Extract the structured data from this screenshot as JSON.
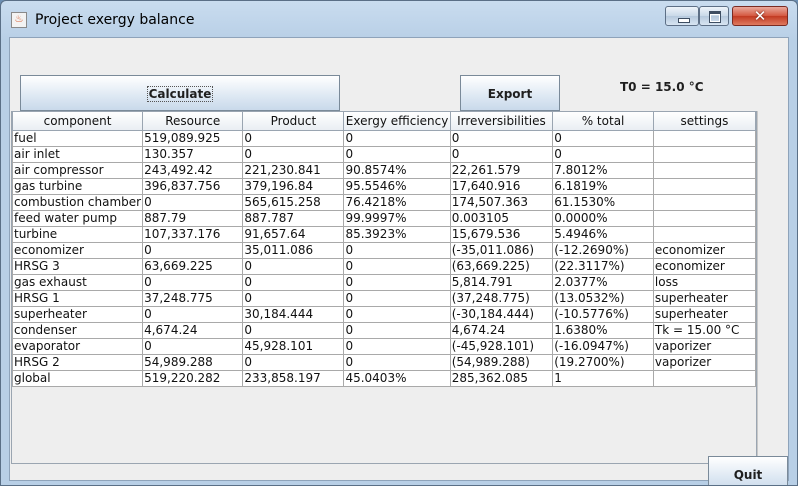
{
  "window": {
    "title": "Project exergy balance",
    "app_icon": "java-cup-icon"
  },
  "toolbar": {
    "calculate_label": "Calculate",
    "export_label": "Export",
    "t0_label": "T0 = 15.0 °C"
  },
  "footer": {
    "quit_label": "Quit"
  },
  "table": {
    "columns": [
      "component",
      "Resource",
      "Product",
      "Exergy efficiency",
      "Irreversibilities",
      "% total",
      "settings"
    ],
    "rows": [
      [
        "fuel",
        "519,089.925",
        "0",
        "0",
        "0",
        "0",
        ""
      ],
      [
        "air inlet",
        "130.357",
        "0",
        "0",
        "0",
        "0",
        ""
      ],
      [
        "air compressor",
        "243,492.42",
        "221,230.841",
        "90.8574%",
        "22,261.579",
        "7.8012%",
        ""
      ],
      [
        "gas turbine",
        "396,837.756",
        "379,196.84",
        "95.5546%",
        "17,640.916",
        "6.1819%",
        ""
      ],
      [
        "combustion chamber",
        "0",
        "565,615.258",
        "76.4218%",
        "174,507.363",
        "61.1530%",
        ""
      ],
      [
        "feed water pump",
        "887.79",
        "887.787",
        "99.9997%",
        "0.003105",
        "0.0000%",
        ""
      ],
      [
        "turbine",
        "107,337.176",
        "91,657.64",
        "85.3923%",
        "15,679.536",
        "5.4946%",
        ""
      ],
      [
        "economizer",
        "0",
        "35,011.086",
        "0",
        "(-35,011.086)",
        "(-12.2690%)",
        "economizer"
      ],
      [
        "HRSG 3",
        "63,669.225",
        "0",
        "0",
        "(63,669.225)",
        "(22.3117%)",
        "economizer"
      ],
      [
        "gas exhaust",
        "0",
        "0",
        "0",
        "5,814.791",
        "2.0377%",
        "loss"
      ],
      [
        "HRSG 1",
        "37,248.775",
        "0",
        "0",
        "(37,248.775)",
        "(13.0532%)",
        "superheater"
      ],
      [
        "superheater",
        "0",
        "30,184.444",
        "0",
        "(-30,184.444)",
        "(-10.5776%)",
        "superheater"
      ],
      [
        "condenser",
        "4,674.24",
        "0",
        "0",
        "4,674.24",
        "1.6380%",
        "Tk = 15.00 °C"
      ],
      [
        "evaporator",
        "0",
        "45,928.101",
        "0",
        "(-45,928.101)",
        "(-16.0947%)",
        "vaporizer"
      ],
      [
        "HRSG 2",
        "54,989.288",
        "0",
        "0",
        "(54,989.288)",
        "(19.2700%)",
        "vaporizer"
      ],
      [
        "global",
        "519,220.282",
        "233,858.197",
        "45.0403%",
        "285,362.085",
        "1",
        ""
      ]
    ]
  }
}
